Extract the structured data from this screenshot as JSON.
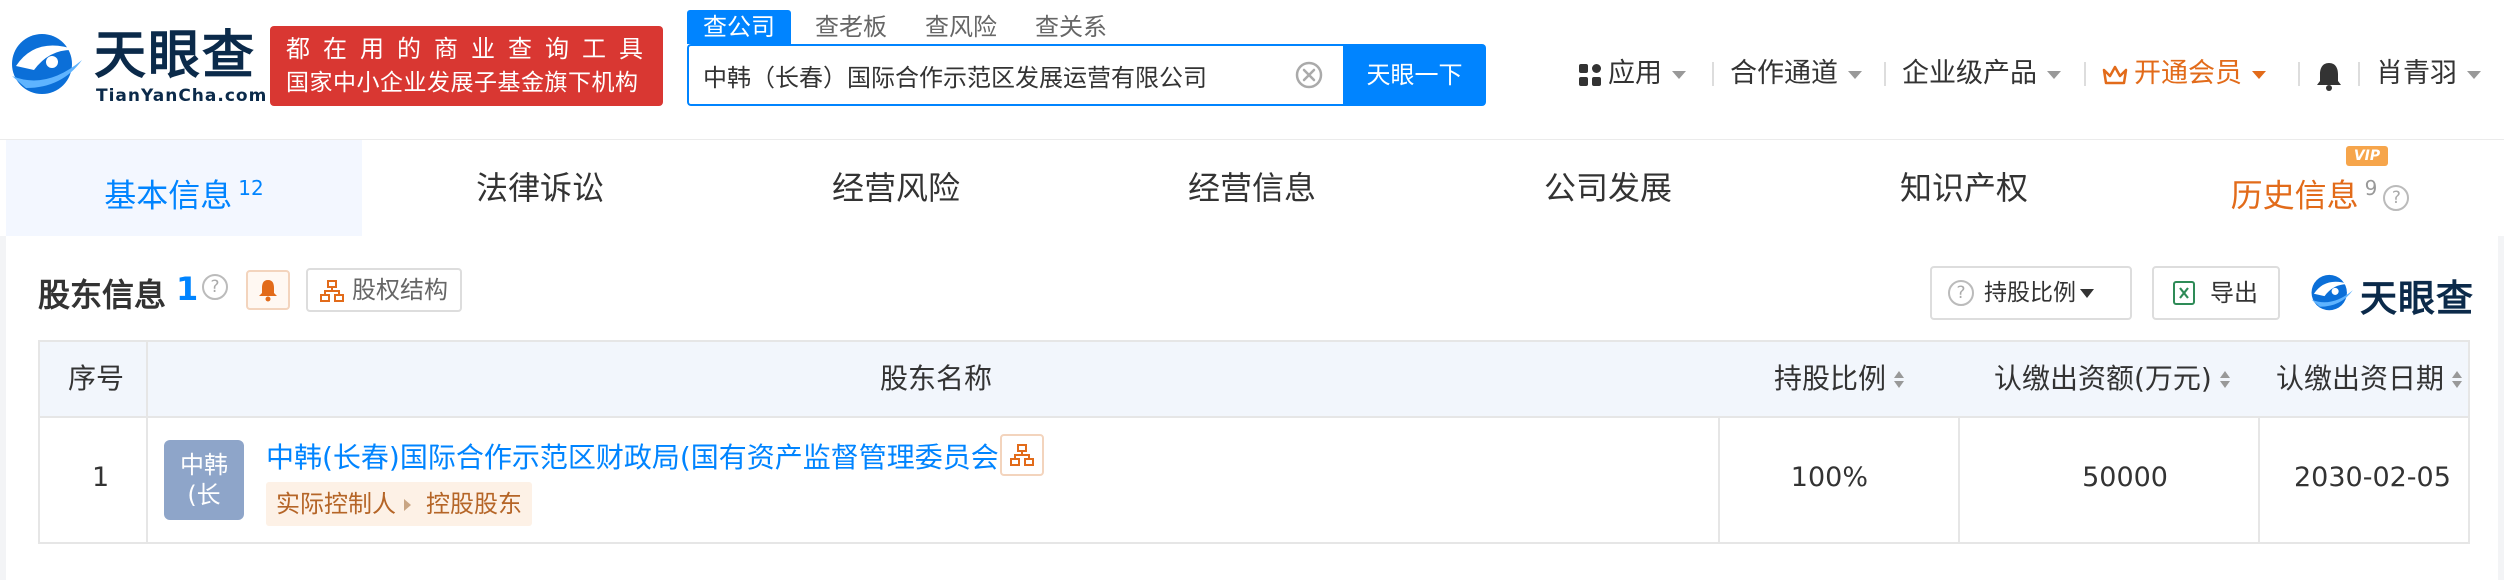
{
  "header": {
    "logo_cn": "天眼查",
    "logo_en": "TianYanCha.com",
    "slogan_line1": "都在用的商业查询工具",
    "slogan_line2": "国家中小企业发展子基金旗下机构",
    "search_tabs": [
      "查公司",
      "查老板",
      "查风险",
      "查关系"
    ],
    "search_value": "中韩（长春）国际合作示范区发展运营有限公司",
    "search_button": "天眼一下",
    "nav": {
      "apps": "应用",
      "channels": "合作通道",
      "enterprise": "企业级产品",
      "vip": "开通会员",
      "user": "肖青羽"
    }
  },
  "tabs": [
    {
      "label": "基本信息",
      "count": "12"
    },
    {
      "label": "法律诉讼"
    },
    {
      "label": "经营风险"
    },
    {
      "label": "经营信息"
    },
    {
      "label": "公司发展"
    },
    {
      "label": "知识产权"
    },
    {
      "label": "历史信息",
      "count": "9",
      "badge": "VIP"
    }
  ],
  "section": {
    "title": "股东信息",
    "count": "1",
    "structure_button": "股权结构",
    "ratio_button": "持股比例",
    "export_button": "导出",
    "watermark": "天眼查"
  },
  "table": {
    "columns": [
      "序号",
      "股东名称",
      "持股比例",
      "认缴出资额(万元)",
      "认缴出资日期"
    ],
    "rows": [
      {
        "index": "1",
        "avatar_text": "中韩(长",
        "name": "中韩(长春)国际合作示范区财政局(国有资产监督管理委员会)",
        "tags": [
          "实际控制人",
          "控股股东"
        ],
        "ratio": "100%",
        "amount": "50000",
        "date": "2030-02-05"
      }
    ]
  },
  "colors": {
    "primary": "#0084ff",
    "brand_red": "#d93732",
    "vip_orange": "#e26b1a",
    "logo_navy": "#0b2a4a"
  }
}
